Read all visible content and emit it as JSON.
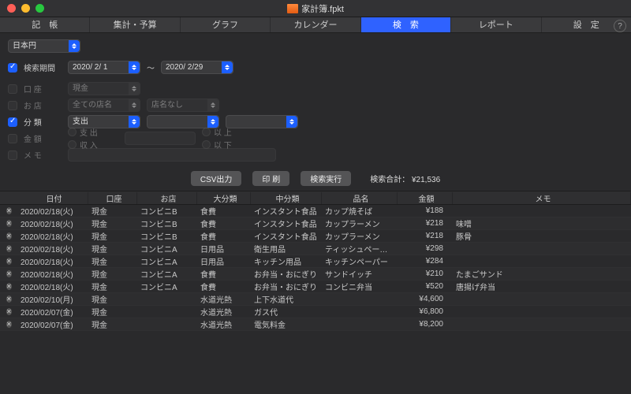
{
  "window": {
    "title": "家計簿.fpkt"
  },
  "tabs": [
    {
      "label": "記　帳"
    },
    {
      "label": "集計・予算"
    },
    {
      "label": "グラフ"
    },
    {
      "label": "カレンダー"
    },
    {
      "label": "検　索"
    },
    {
      "label": "レポート"
    },
    {
      "label": "設　定"
    }
  ],
  "currency": {
    "value": "日本円"
  },
  "filters": {
    "period": {
      "label": "検索期間",
      "checked": true,
      "from": "2020/  2/  1",
      "to": "2020/  2/29",
      "tilde": "〜"
    },
    "account": {
      "label": "口 座",
      "checked": false,
      "value": "現金"
    },
    "shop": {
      "label": "お 店",
      "checked": false,
      "value": "全ての店名",
      "value2": "店名なし"
    },
    "category": {
      "label": "分 類",
      "checked": true,
      "value": "支出",
      "value2": "",
      "value3": ""
    },
    "amount": {
      "label": "金 額",
      "checked": false,
      "r1": "支 出",
      "r2": "収 入",
      "r3": "以 上",
      "r4": "以 下"
    },
    "memo": {
      "label": "メ モ",
      "checked": false,
      "value": ""
    }
  },
  "actions": {
    "csv": "CSV出力",
    "print": "印 刷",
    "run": "検索実行",
    "total_label": "検索合計：",
    "total_value": "¥21,536"
  },
  "columns": {
    "c0": "",
    "c1": "日付",
    "c2": "口座",
    "c3": "お店",
    "c4": "大分類",
    "c5": "中分類",
    "c6": "品名",
    "c7": "金額",
    "c8": "メモ"
  },
  "rows": [
    {
      "date": "2020/02/18(火)",
      "account": "現金",
      "shop": "コンビニB",
      "cat": "食費",
      "sub": "インスタント食品",
      "item": "カップ焼そば",
      "amount": "¥188",
      "memo": ""
    },
    {
      "date": "2020/02/18(火)",
      "account": "現金",
      "shop": "コンビニB",
      "cat": "食費",
      "sub": "インスタント食品",
      "item": "カップラーメン",
      "amount": "¥218",
      "memo": "味噌"
    },
    {
      "date": "2020/02/18(火)",
      "account": "現金",
      "shop": "コンビニB",
      "cat": "食費",
      "sub": "インスタント食品",
      "item": "カップラーメン",
      "amount": "¥218",
      "memo": "豚骨"
    },
    {
      "date": "2020/02/18(火)",
      "account": "現金",
      "shop": "コンビニA",
      "cat": "日用品",
      "sub": "衛生用品",
      "item": "ティッシュペー…",
      "amount": "¥298",
      "memo": ""
    },
    {
      "date": "2020/02/18(火)",
      "account": "現金",
      "shop": "コンビニA",
      "cat": "日用品",
      "sub": "キッチン用品",
      "item": "キッチンペーパー",
      "amount": "¥284",
      "memo": ""
    },
    {
      "date": "2020/02/18(火)",
      "account": "現金",
      "shop": "コンビニA",
      "cat": "食費",
      "sub": "お弁当・おにぎり",
      "item": "サンドイッチ",
      "amount": "¥210",
      "memo": "たまごサンド"
    },
    {
      "date": "2020/02/18(火)",
      "account": "現金",
      "shop": "コンビニA",
      "cat": "食費",
      "sub": "お弁当・おにぎり",
      "item": "コンビニ弁当",
      "amount": "¥520",
      "memo": "唐揚げ弁当"
    },
    {
      "date": "2020/02/10(月)",
      "account": "現金",
      "shop": "",
      "cat": "水道光熱",
      "sub": "上下水道代",
      "item": "",
      "amount": "¥4,600",
      "memo": ""
    },
    {
      "date": "2020/02/07(金)",
      "account": "現金",
      "shop": "",
      "cat": "水道光熱",
      "sub": "ガス代",
      "item": "",
      "amount": "¥6,800",
      "memo": ""
    },
    {
      "date": "2020/02/07(金)",
      "account": "現金",
      "shop": "",
      "cat": "水道光熱",
      "sub": "電気料金",
      "item": "",
      "amount": "¥8,200",
      "memo": ""
    }
  ]
}
